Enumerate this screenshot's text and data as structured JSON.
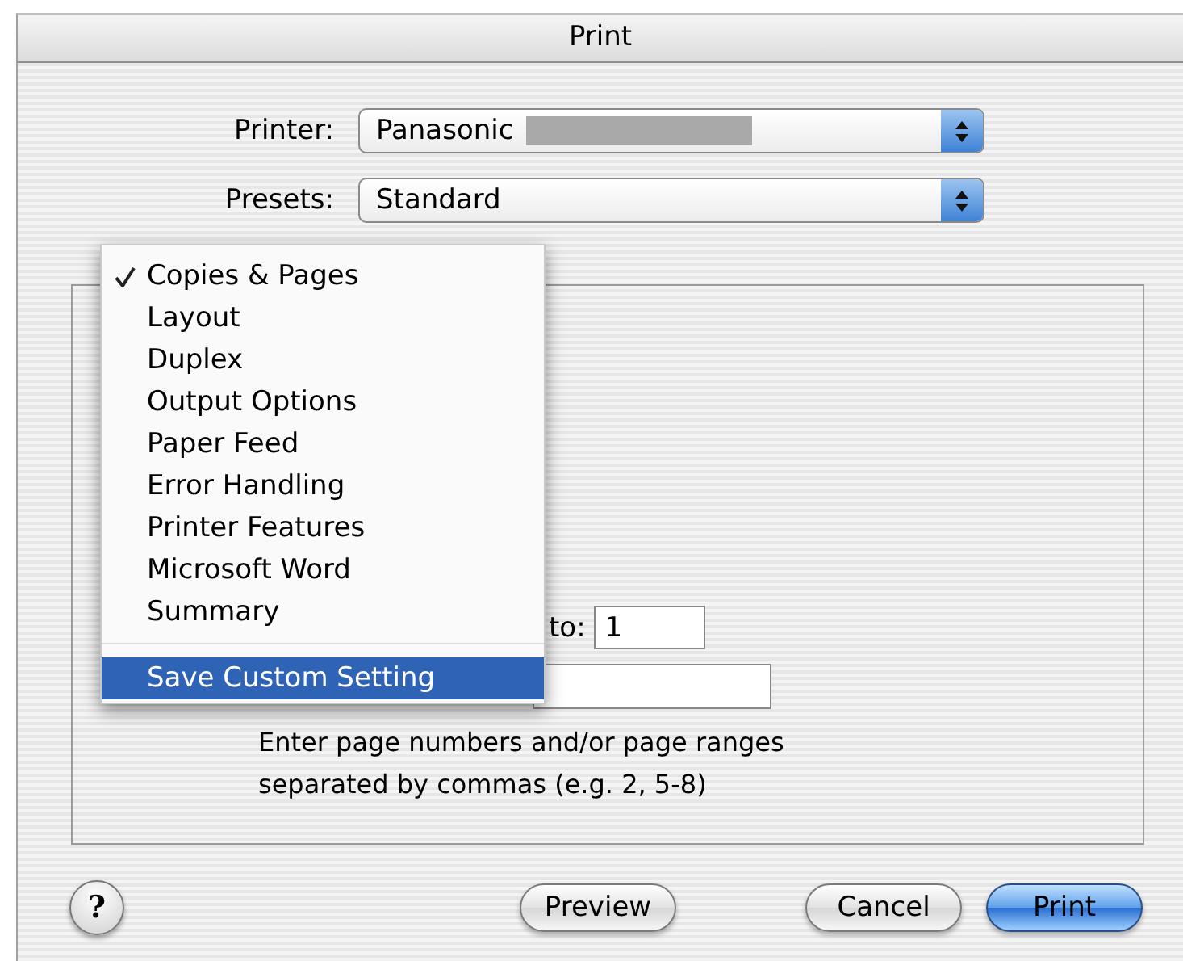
{
  "window": {
    "title": "Print"
  },
  "printer": {
    "label": "Printer:",
    "value": "Panasonic"
  },
  "presets": {
    "label": "Presets:",
    "value": "Standard"
  },
  "panel_menu": {
    "items": [
      {
        "label": "Copies & Pages",
        "kind": "panel",
        "checked": true,
        "selected": false
      },
      {
        "label": "Layout",
        "kind": "panel",
        "checked": false,
        "selected": false
      },
      {
        "label": "Duplex",
        "kind": "panel",
        "checked": false,
        "selected": false
      },
      {
        "label": "Output Options",
        "kind": "panel",
        "checked": false,
        "selected": false
      },
      {
        "label": "Paper Feed",
        "kind": "panel",
        "checked": false,
        "selected": false
      },
      {
        "label": "Error Handling",
        "kind": "panel",
        "checked": false,
        "selected": false
      },
      {
        "label": "Printer Features",
        "kind": "panel",
        "checked": false,
        "selected": false
      },
      {
        "label": "Microsoft Word",
        "kind": "panel",
        "checked": false,
        "selected": false
      },
      {
        "label": "Summary",
        "kind": "panel",
        "checked": false,
        "selected": false
      },
      {
        "label": "Save Custom Setting",
        "kind": "command",
        "checked": false,
        "selected": true
      }
    ]
  },
  "pages": {
    "to_label": "to:",
    "to_value": "1",
    "hint": "Enter page numbers and/or page ranges\nseparated by commas (e.g. 2, 5-8)"
  },
  "help_button": {
    "label": "?"
  },
  "buttons": [
    {
      "label": "Preview",
      "kind": "normal"
    },
    {
      "label": "Cancel",
      "kind": "normal"
    },
    {
      "label": "Print",
      "kind": "default"
    }
  ]
}
